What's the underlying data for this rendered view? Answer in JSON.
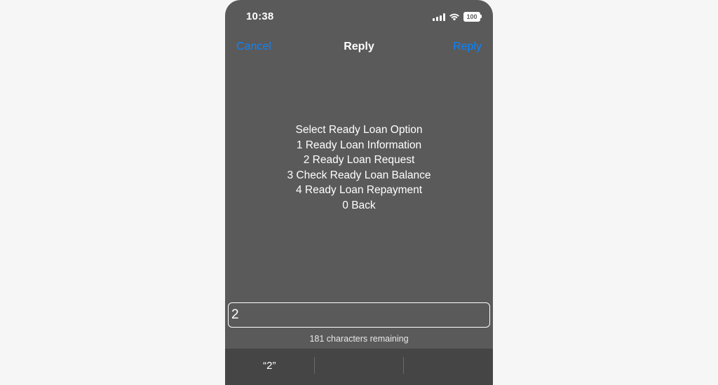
{
  "status_bar": {
    "time": "10:38",
    "battery": "100",
    "icons": [
      "signal-icon",
      "wifi-icon",
      "battery-icon"
    ]
  },
  "nav": {
    "cancel_label": "Cancel",
    "title": "Reply",
    "reply_label": "Reply"
  },
  "message": {
    "lines": [
      "Select Ready Loan Option",
      "1 Ready Loan Information",
      "2 Ready Loan Request",
      "3 Check Ready Loan Balance",
      "4 Ready Loan Repayment",
      "0 Back"
    ]
  },
  "input": {
    "value": "2"
  },
  "char_count": "181 characters remaining",
  "suggestions": [
    "“2”",
    "",
    ""
  ],
  "colors": {
    "accent": "#0a84ff",
    "background": "#5a5a5a",
    "keyboard_bar": "#454545"
  }
}
